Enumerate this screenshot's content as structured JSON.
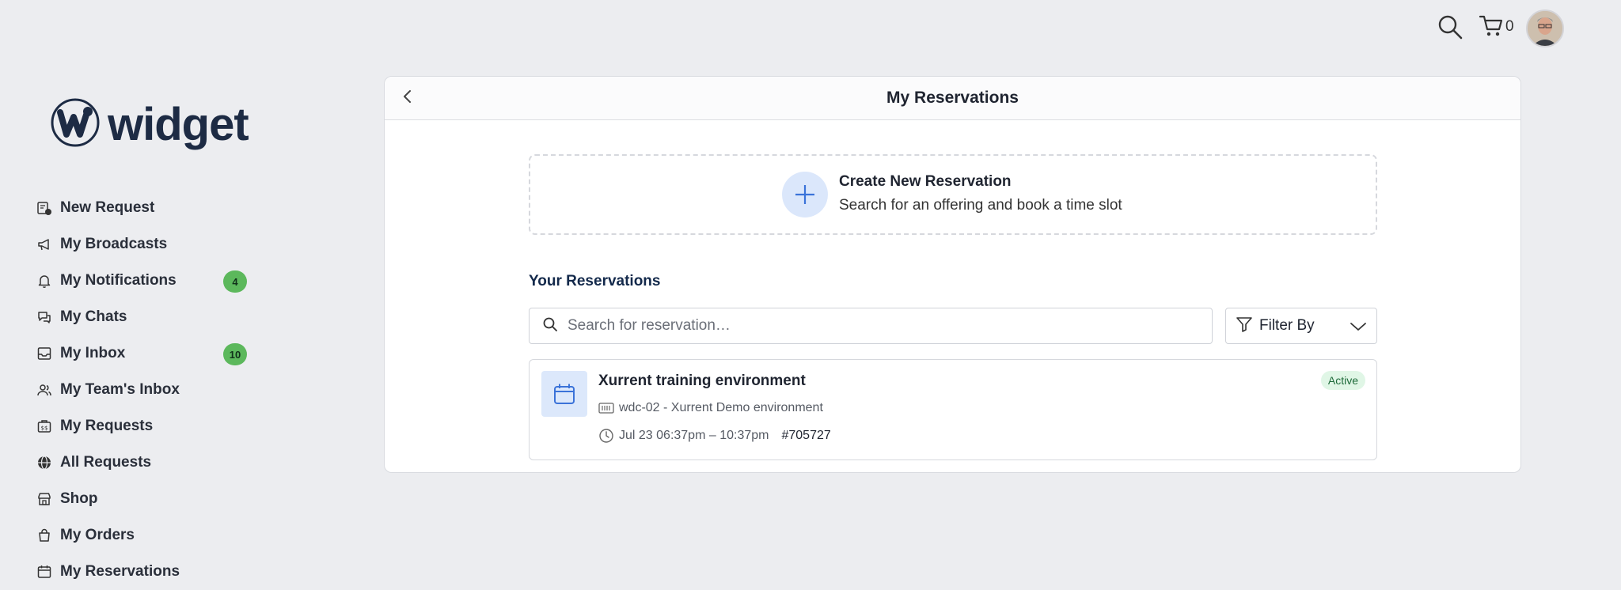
{
  "topbar": {
    "cart_count": "0"
  },
  "brand": {
    "name": "widget"
  },
  "sidebar": {
    "items": [
      {
        "label": "New Request",
        "icon": "new-request-icon",
        "badge": null
      },
      {
        "label": "My Broadcasts",
        "icon": "megaphone-icon",
        "badge": null
      },
      {
        "label": "My Notifications",
        "icon": "bell-icon",
        "badge": "4"
      },
      {
        "label": "My Chats",
        "icon": "chat-icon",
        "badge": null
      },
      {
        "label": "My Inbox",
        "icon": "inbox-icon",
        "badge": "10"
      },
      {
        "label": "My Team's Inbox",
        "icon": "team-icon",
        "badge": null
      },
      {
        "label": "My Requests",
        "icon": "requests-icon",
        "badge": null
      },
      {
        "label": "All Requests",
        "icon": "globe-icon",
        "badge": null
      },
      {
        "label": "Shop",
        "icon": "store-icon",
        "badge": null
      },
      {
        "label": "My Orders",
        "icon": "bag-icon",
        "badge": null
      },
      {
        "label": "My Reservations",
        "icon": "calendar-icon",
        "badge": null
      }
    ]
  },
  "main": {
    "title": "My Reservations",
    "create": {
      "title": "Create New Reservation",
      "subtitle": "Search for an offering and book a time slot"
    },
    "section_title": "Your Reservations",
    "search": {
      "placeholder": "Search for reservation…"
    },
    "filter": {
      "label": "Filter By"
    },
    "reservations": [
      {
        "name": "Xurrent training environment",
        "environment": "wdc-02 - Xurrent Demo environment",
        "time": "Jul 23 06:37pm – 10:37pm",
        "id": "#705727",
        "status": "Active"
      }
    ]
  },
  "colors": {
    "accent": "#3b73d9",
    "badge_green": "#5cb85c",
    "status_active_bg": "#e0f6e6",
    "status_active_text": "#1e6b3a",
    "heading_navy": "#13294b"
  }
}
